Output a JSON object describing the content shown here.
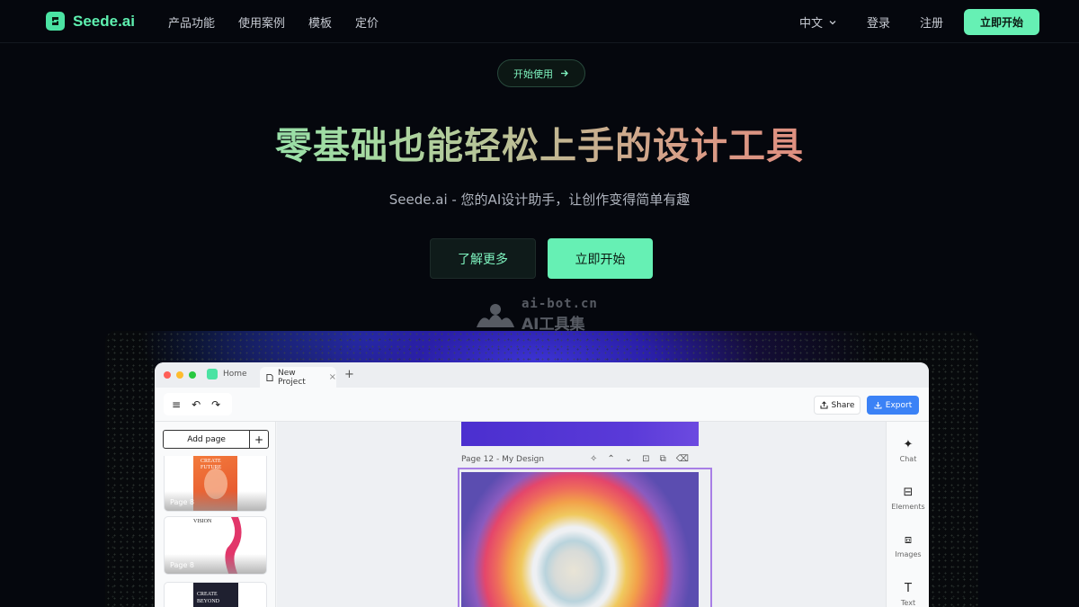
{
  "nav": {
    "brand": "Seede.ai",
    "links": [
      "产品功能",
      "使用案例",
      "模板",
      "定价"
    ],
    "language": "中文",
    "login": "登录",
    "register": "注册",
    "cta": "立即开始"
  },
  "hero": {
    "pill": "开始使用",
    "title": "零基础也能轻松上手的设计工具",
    "subtitle": "Seede.ai - 您的AI设计助手，让创作变得简单有趣",
    "btn_more": "了解更多",
    "btn_start": "立即开始"
  },
  "watermark": {
    "line1": "ai-bot.cn",
    "line2": "AI工具集"
  },
  "app": {
    "tabs": {
      "home": "Home",
      "active": "New Project"
    },
    "toolbar": {
      "share": "Share",
      "export": "Export"
    },
    "left": {
      "add_page": "Add page",
      "thumbs": [
        {
          "label": "Page 8",
          "title": "CREATE FUTURE"
        },
        {
          "label": "Page 8",
          "title": "VISION"
        },
        {
          "label": "",
          "title": "CREATE BEYOND"
        }
      ]
    },
    "page_header": "Page 12 - My Design",
    "right": [
      "Chat",
      "Elements",
      "Images",
      "Text"
    ]
  },
  "colors": {
    "accent": "#66f0b4",
    "background": "#05070d",
    "export": "#3b82f6",
    "selection": "#a87fe6"
  }
}
